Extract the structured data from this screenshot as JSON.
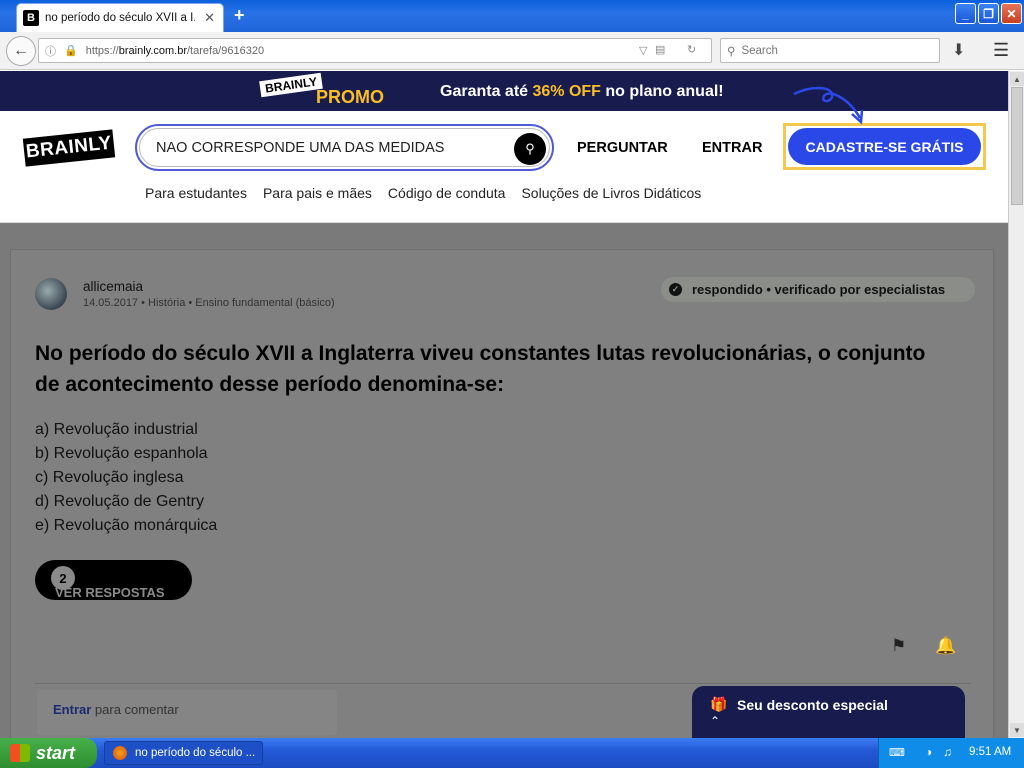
{
  "browser": {
    "tab_title": "no período do século XVII a I...",
    "tab_close": "✕",
    "new_tab": "+",
    "url_prefix": "https://",
    "url_domain": "brainly.com.br",
    "url_path": "/tarefa/9616320",
    "search_placeholder": "Search",
    "window_controls": [
      "_",
      "❐",
      "✕"
    ]
  },
  "promo": {
    "logo": "BRAINLY",
    "word": "PROMO",
    "text_before": "Garanta até ",
    "highlight": "36% OFF",
    "text_after": " no plano anual!"
  },
  "header": {
    "logo": "BRAINLY",
    "search_value": "NAO CORRESPONDE UMA DAS MEDIDAS",
    "ask_label": "PERGUNTAR",
    "login_label": "ENTRAR",
    "signup_label": "CADASTRE-SE GRÁTIS",
    "subnav": [
      "Para estudantes",
      "Para pais e mães",
      "Código de conduta",
      "Soluções de Livros Didáticos"
    ]
  },
  "question": {
    "author": "allicemaia",
    "date": "14.05.2017",
    "subject": "História",
    "level": "Ensino fundamental (básico)",
    "badge": "respondido • verificado por especialistas",
    "text": "No período do século XVII a Inglaterra viveu constantes lutas revolucionárias, o conjunto de acontecimento desse período denomina-se:",
    "options": [
      "a) Revolução industrial",
      "b) Revolução espanhola",
      "c) Revolução inglesa",
      "d) Revolução de Gentry",
      "e) Revolução monárquica"
    ],
    "answers_count": "2",
    "answers_label": "VER RESPOSTAS",
    "comment_link": "Entrar",
    "comment_text": " para comentar"
  },
  "discount": {
    "label": "Seu desconto especial"
  },
  "taskbar": {
    "start": "start",
    "task": "no período do século ...",
    "clock": "9:51 AM"
  },
  "colors": {
    "promo_bg": "#171b4e",
    "promo_accent": "#fbbf24",
    "signup_bg": "#2a48e8",
    "signup_border": "#f2c94c"
  }
}
